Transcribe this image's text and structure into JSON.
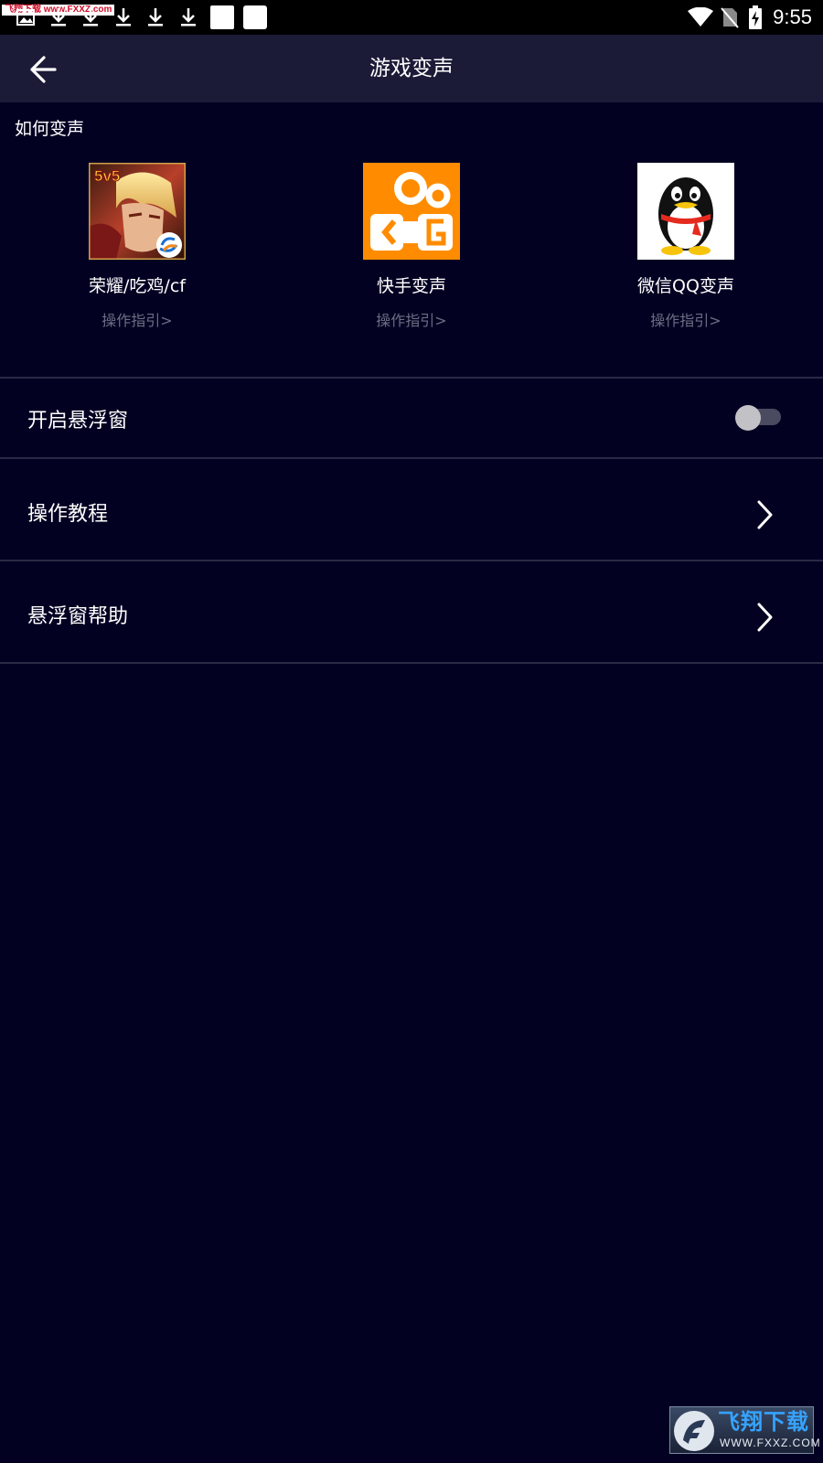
{
  "status_bar": {
    "watermark_text": "飞翔下载 www.FXXZ.com",
    "time": "9:55",
    "icons": [
      "image-icon",
      "download-icon",
      "download-icon",
      "download-icon",
      "download-icon",
      "download-icon",
      "blank-square-icon",
      "blank-square-icon",
      "wifi-icon",
      "no-sim-icon",
      "battery-charging-icon"
    ]
  },
  "header": {
    "title": "游戏变声",
    "back_icon": "arrow-left-icon"
  },
  "how_to": {
    "label": "如何变声",
    "apps": [
      {
        "name": "荣耀/吃鸡/cf",
        "guide": "操作指引>",
        "icon": "honor-of-kings-icon",
        "icon_badge": "5v5"
      },
      {
        "name": "快手变声",
        "guide": "操作指引>",
        "icon": "kuaishou-icon"
      },
      {
        "name": "微信QQ变声",
        "guide": "操作指引>",
        "icon": "qq-penguin-icon"
      }
    ]
  },
  "settings": {
    "floating_window": {
      "label": "开启悬浮窗",
      "enabled": false
    },
    "tutorial": {
      "label": "操作教程",
      "icon": "chevron-right-icon"
    },
    "floating_help": {
      "label": "悬浮窗帮助",
      "icon": "chevron-right-icon"
    }
  },
  "watermark": {
    "title": "飞翔下载",
    "url": "WWW.FXXZ.COM"
  },
  "colors": {
    "background": "#020122",
    "app_bar": "#1b1b38",
    "guide_text": "#6d6d84",
    "kuaishou_orange": "#ff8c00"
  }
}
